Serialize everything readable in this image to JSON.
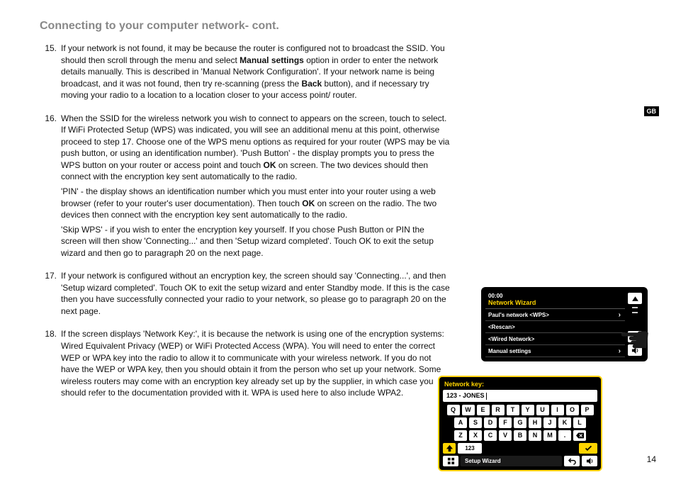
{
  "title": "Connecting to your computer network- cont.",
  "lang_tab": "GB",
  "page_number": "14",
  "items": [
    {
      "n": "15.",
      "paras": [
        {
          "pre": "If your network is not found, it may be because the router is configured not to broadcast the SSID. You should then scroll through the menu and select ",
          "b": "Manual settings",
          "post": " option in order to enter the network details manually. This is described in 'Manual Network Configuration'. If your network name is being broadcast, and it was not found, then try re-scanning (press the ",
          "b2": "Back",
          "post2": " button), and if necessary try moving your radio to a location to a location closer to your access point/ router."
        }
      ]
    },
    {
      "n": "16.",
      "paras": [
        {
          "pre": "When the SSID for the wireless network you wish to connect to appears on the screen, touch to select. If WiFi Protected Setup (WPS) was indicated, you will see an additional menu at this point, otherwise proceed to step 17. Choose one of the WPS menu options as required for your router (WPS may be via push button, or using an identification number). 'Push Button' - the display prompts you to press the WPS button on your router or access point and touch ",
          "b": "OK",
          "post": " on screen. The two devices should then connect with the encryption key sent automatically to the radio."
        },
        {
          "pre": "'PIN' - the display shows an identification number which you must enter into your router using a web browser (refer to your router's user documentation). Then touch ",
          "b": "OK",
          "post": " on screen on the radio. The two devices then connect with the encryption key sent automatically to the radio."
        },
        {
          "text": "'Skip WPS' - if you wish to enter the encryption key yourself. If you chose Push Button or PIN the screen will then show 'Connecting...' and then 'Setup wizard completed'. Touch OK to exit the setup wizard and then go to paragraph 20 on the next page."
        }
      ]
    },
    {
      "n": "17.",
      "paras": [
        {
          "text": "If your network is configured without an encryption key, the screen should say 'Connecting...', and then 'Setup wizard completed'. Touch OK to exit the setup wizard and enter Standby mode. If this is the case then you have successfully connected your radio to your network, so please go to paragraph 20 on the next page."
        }
      ]
    },
    {
      "n": "18.",
      "paras": [
        {
          "text": "If the screen displays 'Network Key:', it is because the network is using one of the encryption systems: Wired Equivalent Privacy (WEP)  or WiFi Protected Access (WPA). You will need to enter the correct WEP or WPA key into the radio to allow it to communicate with your wireless network. If you do not have the WEP or WPA key, then you should obtain it from the person who set up your network. Some wireless routers may come with an encryption key already set up by the supplier, in which case you should refer to the documentation provided with it. WPA is used here to also include WPA2."
        }
      ]
    }
  ],
  "deviceA": {
    "time": "00:00",
    "header": "Network Wizard",
    "rows": [
      "Paul's network <WPS>",
      "<Rescan>",
      "<Wired Network>",
      "Manual settings"
    ]
  },
  "deviceB": {
    "title": "Network key:",
    "input": "123 - JONES",
    "rows": [
      [
        "Q",
        "W",
        "E",
        "R",
        "T",
        "Y",
        "U",
        "I",
        "O",
        "P"
      ],
      [
        "A",
        "S",
        "D",
        "F",
        "G",
        "H",
        "J",
        "K",
        "L"
      ],
      [
        "Z",
        "X",
        "C",
        "V",
        "B",
        "N",
        "M",
        "."
      ]
    ],
    "numkey": "123",
    "wizard": "Setup Wizard"
  }
}
